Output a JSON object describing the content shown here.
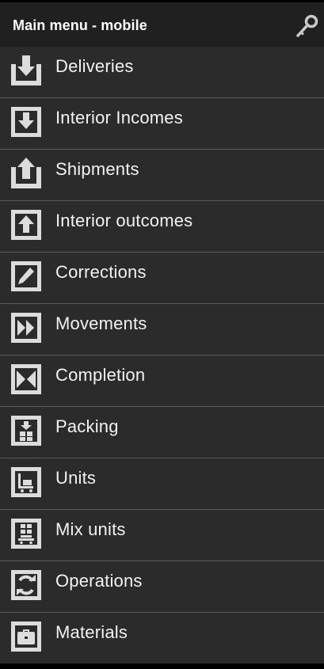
{
  "header": {
    "title": "Main menu - mobile",
    "icon": "key-icon"
  },
  "menu": {
    "items": [
      {
        "label": "Deliveries",
        "icon": "download-tray-icon"
      },
      {
        "label": "Interior Incomes",
        "icon": "arrow-down-box-icon"
      },
      {
        "label": "Shipments",
        "icon": "upload-tray-icon"
      },
      {
        "label": "Interior outcomes",
        "icon": "arrow-up-box-icon"
      },
      {
        "label": "Corrections",
        "icon": "pencil-icon"
      },
      {
        "label": "Movements",
        "icon": "fast-forward-icon"
      },
      {
        "label": "Completion",
        "icon": "bowtie-icon"
      },
      {
        "label": "Packing",
        "icon": "package-icon"
      },
      {
        "label": "Units",
        "icon": "cart-icon"
      },
      {
        "label": "Mix units",
        "icon": "mixed-pallet-icon"
      },
      {
        "label": "Operations",
        "icon": "refresh-icon"
      },
      {
        "label": "Materials",
        "icon": "briefcase-icon"
      }
    ]
  },
  "colors": {
    "background": "#2b2b2b",
    "header": "#202020",
    "divider": "#5a5a5a",
    "icon_frame": "#dcdcdc",
    "text": "#f2f2f2"
  }
}
